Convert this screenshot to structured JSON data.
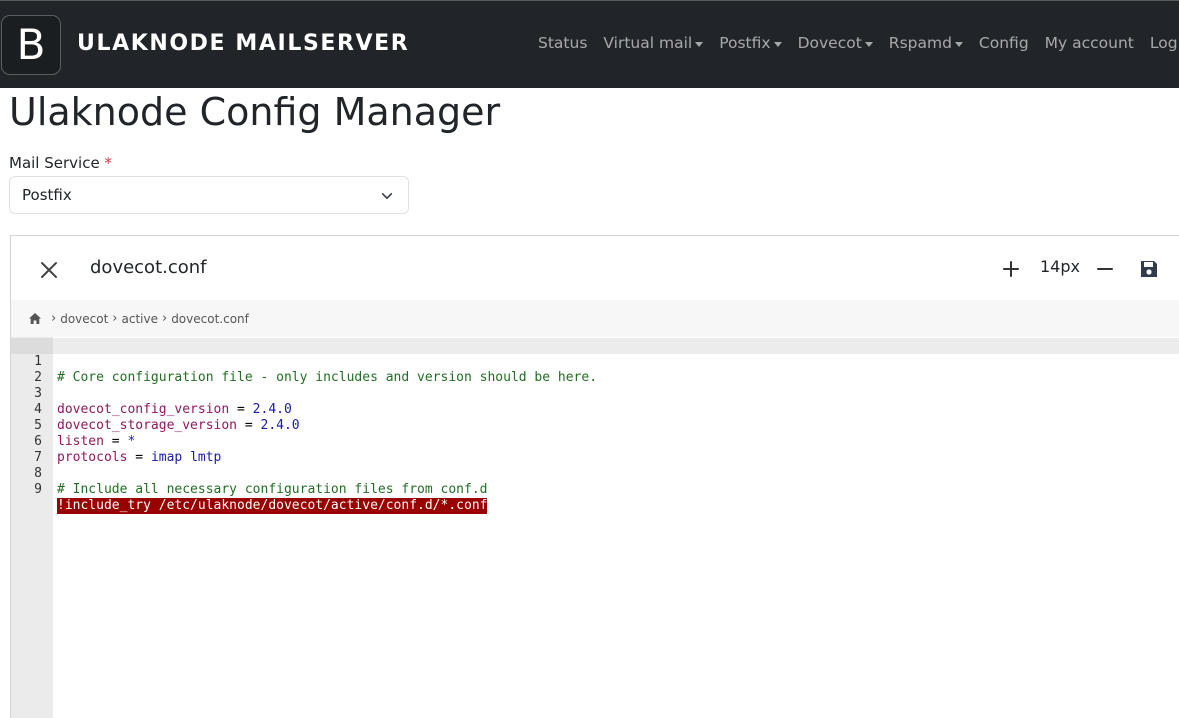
{
  "navbar": {
    "logo_letter": "B",
    "brand": "ULAKNODE MAILSERVER",
    "items": [
      {
        "label": "Status",
        "dropdown": false
      },
      {
        "label": "Virtual mail",
        "dropdown": true
      },
      {
        "label": "Postfix",
        "dropdown": true
      },
      {
        "label": "Dovecot",
        "dropdown": true
      },
      {
        "label": "Rspamd",
        "dropdown": true
      },
      {
        "label": "Config",
        "dropdown": false
      },
      {
        "label": "My account",
        "dropdown": false
      },
      {
        "label": "Log out",
        "dropdown": false
      }
    ]
  },
  "page_title": "Ulaknode Config Manager",
  "form": {
    "label": "Mail Service",
    "required_mark": "*",
    "selected": "Postfix"
  },
  "editor": {
    "file_name": "dovecot.conf",
    "font_size": "14px",
    "breadcrumb": [
      "dovecot",
      "active",
      "dovecot.conf"
    ],
    "lines": [
      {
        "n": "1",
        "text": "# Core configuration file - only includes and version should be here.",
        "kind": "comment"
      },
      {
        "n": "2",
        "text": "",
        "kind": "plain"
      },
      {
        "n": "3",
        "key": "dovecot_config_version",
        "op": " = ",
        "val": "2.4.0",
        "kind": "kv"
      },
      {
        "n": "4",
        "key": "dovecot_storage_version",
        "op": " = ",
        "val": "2.4.0",
        "kind": "kv"
      },
      {
        "n": "5",
        "key": "listen",
        "op": " = ",
        "val": "*",
        "kind": "kv"
      },
      {
        "n": "6",
        "key": "protocols",
        "op": " = ",
        "val": "imap lmtp",
        "kind": "kv"
      },
      {
        "n": "7",
        "text": "",
        "kind": "plain"
      },
      {
        "n": "8",
        "text": "# Include all necessary configuration files from conf.d",
        "kind": "comment"
      },
      {
        "n": "9",
        "text": "!include_try /etc/ulaknode/dovecot/active/conf.d/*.conf",
        "kind": "error"
      }
    ]
  },
  "colors": {
    "navbar_bg": "#212529",
    "comment": "#236e24",
    "key": "#91185b",
    "value": "#1a1aa6",
    "error_bg": "#990000",
    "required": "#dc3545"
  },
  "icons": [
    "home-icon",
    "close-icon",
    "plus-icon",
    "minus-icon",
    "save-icon",
    "chevron-down-icon"
  ]
}
